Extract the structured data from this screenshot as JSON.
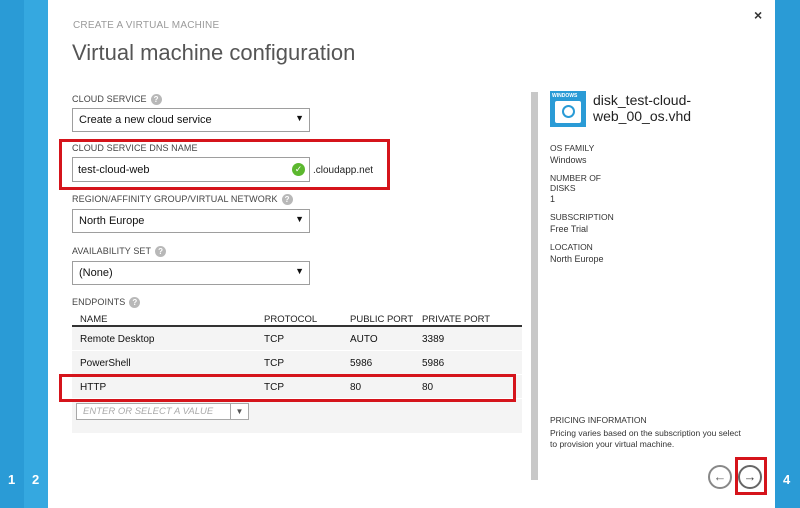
{
  "wizard": {
    "title_small": "CREATE A VIRTUAL MACHINE",
    "title": "Virtual machine configuration",
    "close_glyph": "×",
    "steps": [
      "1",
      "2",
      "4"
    ]
  },
  "fields": {
    "cloud_service": {
      "label": "CLOUD SERVICE",
      "value": "Create a new cloud service"
    },
    "dns_name": {
      "label": "CLOUD SERVICE DNS NAME",
      "value": "test-cloud-web",
      "suffix": ".cloudapp.net"
    },
    "region": {
      "label": "REGION/AFFINITY GROUP/VIRTUAL NETWORK",
      "value": "North Europe"
    },
    "availability_set": {
      "label": "AVAILABILITY SET",
      "value": "(None)"
    }
  },
  "endpoints": {
    "label": "ENDPOINTS",
    "columns": [
      "NAME",
      "PROTOCOL",
      "PUBLIC PORT",
      "PRIVATE PORT"
    ],
    "rows": [
      {
        "name": "Remote Desktop",
        "protocol": "TCP",
        "public": "AUTO",
        "private": "3389"
      },
      {
        "name": "PowerShell",
        "protocol": "TCP",
        "public": "5986",
        "private": "5986"
      },
      {
        "name": "HTTP",
        "protocol": "TCP",
        "public": "80",
        "private": "80"
      }
    ],
    "add_placeholder": "ENTER OR SELECT A VALUE"
  },
  "summary": {
    "icon_text": "WINDOWS",
    "disk_name": "disk_test-cloud-web_00_os.vhd",
    "os_family_label": "OS FAMILY",
    "os_family": "Windows",
    "disks_label": "NUMBER OF DISKS",
    "disks": "1",
    "subscription_label": "SUBSCRIPTION",
    "subscription": "Free Trial",
    "location_label": "LOCATION",
    "location": "North Europe",
    "pricing_label": "PRICING INFORMATION",
    "pricing_text": "Pricing varies based on the subscription you select to provision your virtual machine."
  },
  "nav": {
    "back_glyph": "←",
    "next_glyph": "→"
  },
  "colors": {
    "accent": "#2a9bd6",
    "highlight": "#d5141b",
    "valid": "#5cb82f"
  }
}
